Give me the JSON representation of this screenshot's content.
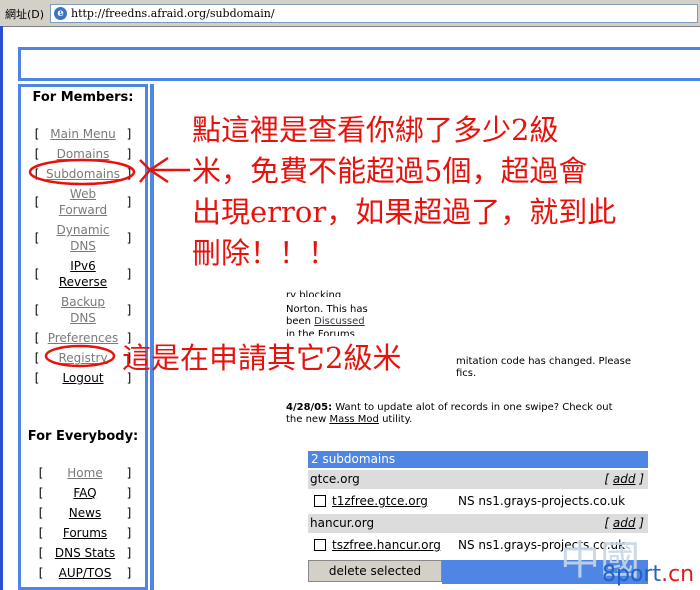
{
  "browser": {
    "address_label": "網址(D)",
    "url": "http://freedns.afraid.org/subdomain/"
  },
  "sidebar": {
    "members_heading": "For Members:",
    "member_items": [
      {
        "label": "Main Menu"
      },
      {
        "label": "Domains"
      },
      {
        "label": "Subdomains"
      },
      {
        "label": "Web Forward"
      },
      {
        "label": "Dynamic DNS"
      },
      {
        "label": "IPv6 Reverse"
      },
      {
        "label": "Backup DNS"
      },
      {
        "label": "Preferences"
      },
      {
        "label": "Registry"
      },
      {
        "label": "Logout"
      }
    ],
    "everybody_heading": "For Everybody:",
    "everybody_items": [
      {
        "label": "Home"
      },
      {
        "label": "FAQ"
      },
      {
        "label": "News"
      },
      {
        "label": "Forums"
      },
      {
        "label": "DNS Stats"
      },
      {
        "label": "AUP/TOS"
      }
    ]
  },
  "annotations": {
    "top_lines": [
      "點這裡是查看你綁了多少2級",
      "米，免費不能超過5個，超過會",
      "出現error，如果超過了，就到此",
      "刪除！！！"
    ],
    "registry_note": "這是在申請其它2級米"
  },
  "fragments": {
    "line1": "ry blocking",
    "line2": "Norton. This has",
    "line3_pre": "been ",
    "line3_link": "Discussed",
    "line4": "in the Forums",
    "line5": "mitation code has changed. Please",
    "line6": "fics."
  },
  "news": {
    "date": "4/28/05:",
    "text1": " Want to update alot of records in one swipe? Check out",
    "text2_pre": "the new ",
    "link": "Mass Mod",
    "text2_post": " utility."
  },
  "subdomains": {
    "header": "2 subdomains",
    "groups": [
      {
        "domain": "gtce.org",
        "add": "add",
        "record": {
          "subdomain": "t1zfree.gtce.org",
          "ns": "NS ns1.grays-projects.co.uk"
        }
      },
      {
        "domain": "hancur.org",
        "add": "add",
        "record": {
          "subdomain": "tszfree.hancur.org",
          "ns": "NS ns1.grays-projects.co.uk"
        }
      }
    ],
    "delete_button": "delete selected"
  },
  "watermark": {
    "text_a": "中國",
    "text_b": "8port",
    "text_c": ".cn"
  },
  "colors": {
    "accent": "#4f86e6",
    "annotation": "#e8120c"
  }
}
